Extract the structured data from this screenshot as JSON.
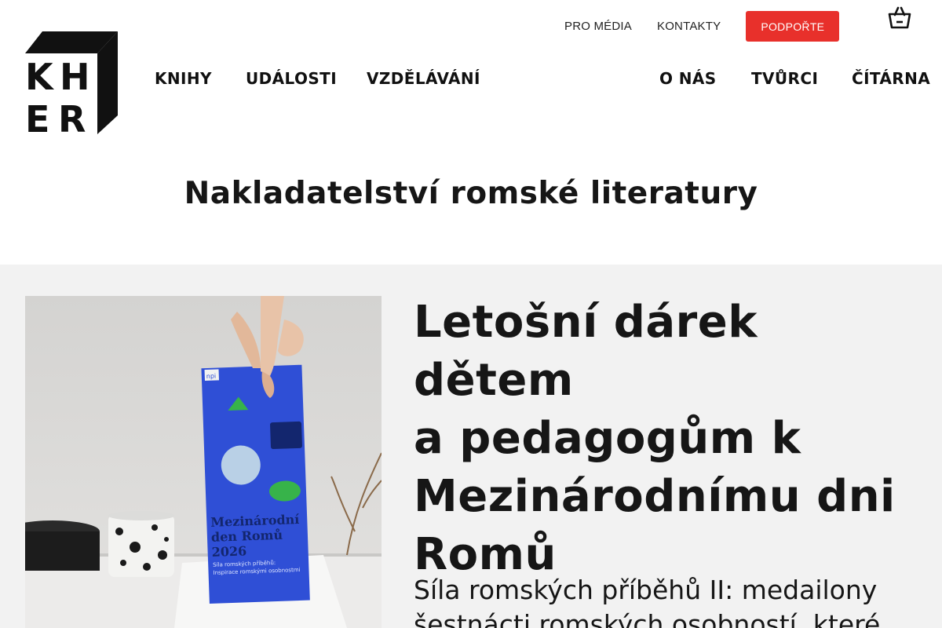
{
  "logo": {
    "letters": [
      "K",
      "H",
      "E",
      "R"
    ],
    "icon": "kher-cube-logo"
  },
  "top_links": {
    "media": "PRO MÉDIA",
    "contacts": "KONTAKTY",
    "support": "PODPOŘTE"
  },
  "cart": {
    "icon": "shopping-basket-icon"
  },
  "main_nav": {
    "left": [
      "KNIHY",
      "UDÁLOSTI",
      "VZDĚLÁVÁNÍ"
    ],
    "right": [
      "O NÁS",
      "TVŮRCI",
      "ČÍTÁRNA"
    ]
  },
  "tagline": "Nakladatelství romské literatury",
  "hero": {
    "title_lines": [
      "Letošní dárek dětem",
      "a pedagogům k",
      "Mezinárodnímu dni",
      "Romů"
    ],
    "subtitle_lines": [
      "Síla romských příběhů II: medailony",
      "šestnácti romských osobností, které"
    ],
    "image": {
      "booklet_logo": "npi",
      "booklet_title_lines": [
        "Mezinárodní",
        "den Romů",
        "2026"
      ],
      "booklet_sub_lines": [
        "Síla romských příběhů:",
        "Inspirace romskými osobnostmi"
      ]
    }
  },
  "colors": {
    "accent_red": "#e8302b",
    "booklet_blue": "#2f4fd6",
    "hero_bg": "#f2f2f2",
    "text": "#161616"
  }
}
